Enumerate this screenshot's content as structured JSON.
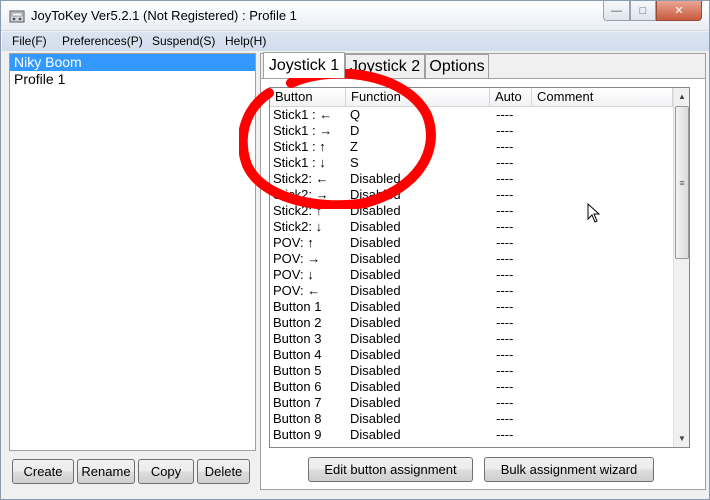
{
  "window": {
    "title": "JoyToKey Ver5.2.1 (Not Registered) : Profile 1",
    "controls": {
      "minimize": "—",
      "maximize": "□",
      "close": "✕"
    }
  },
  "menu": [
    "File(F)",
    "Preferences(P)",
    "Suspend(S)",
    "Help(H)"
  ],
  "profiles": [
    "Niky Boom",
    "Profile 1"
  ],
  "profile_buttons": {
    "create": "Create",
    "rename": "Rename",
    "copy": "Copy",
    "delete": "Delete"
  },
  "tabs": [
    "Joystick 1",
    "Joystick 2",
    "Options"
  ],
  "grid": {
    "columns": [
      "Button",
      "Function",
      "Auto",
      "Comment"
    ],
    "rows": [
      {
        "button": "Stick1 : ←",
        "function": "Q",
        "auto": "----"
      },
      {
        "button": "Stick1 : →",
        "function": "D",
        "auto": "----"
      },
      {
        "button": "Stick1 : ↑",
        "function": "Z",
        "auto": "----"
      },
      {
        "button": "Stick1 : ↓",
        "function": "S",
        "auto": "----"
      },
      {
        "button": "Stick2: ←",
        "function": "Disabled",
        "auto": "----"
      },
      {
        "button": "Stick2: →",
        "function": "Disabled",
        "auto": "----"
      },
      {
        "button": "Stick2: ↑",
        "function": "Disabled",
        "auto": "----"
      },
      {
        "button": "Stick2: ↓",
        "function": "Disabled",
        "auto": "----"
      },
      {
        "button": "POV: ↑",
        "function": "Disabled",
        "auto": "----"
      },
      {
        "button": "POV: →",
        "function": "Disabled",
        "auto": "----"
      },
      {
        "button": "POV: ↓",
        "function": "Disabled",
        "auto": "----"
      },
      {
        "button": "POV: ←",
        "function": "Disabled",
        "auto": "----"
      },
      {
        "button": "Button 1",
        "function": "Disabled",
        "auto": "----"
      },
      {
        "button": "Button 2",
        "function": "Disabled",
        "auto": "----"
      },
      {
        "button": "Button 3",
        "function": "Disabled",
        "auto": "----"
      },
      {
        "button": "Button 4",
        "function": "Disabled",
        "auto": "----"
      },
      {
        "button": "Button 5",
        "function": "Disabled",
        "auto": "----"
      },
      {
        "button": "Button 6",
        "function": "Disabled",
        "auto": "----"
      },
      {
        "button": "Button 7",
        "function": "Disabled",
        "auto": "----"
      },
      {
        "button": "Button 8",
        "function": "Disabled",
        "auto": "----"
      },
      {
        "button": "Button 9",
        "function": "Disabled",
        "auto": "----"
      }
    ]
  },
  "actions": {
    "edit": "Edit button assignment",
    "bulk": "Bulk assignment wizard"
  },
  "colors": {
    "selection": "#3399ff",
    "annotation": "#ff0000"
  }
}
